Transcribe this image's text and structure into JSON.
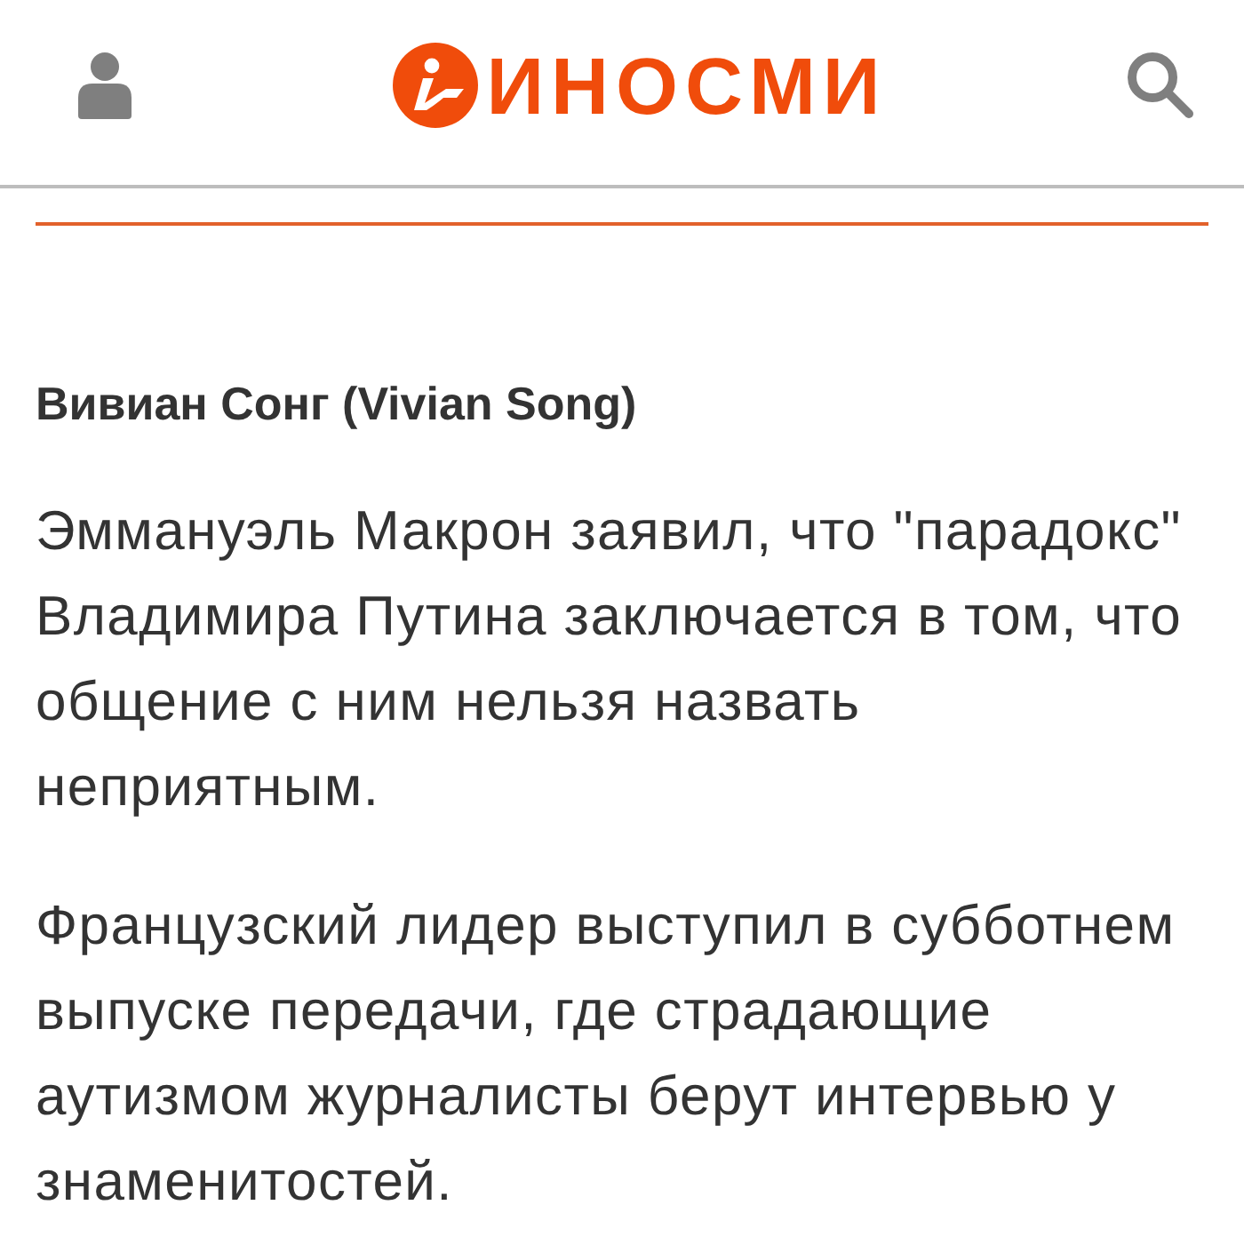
{
  "header": {
    "logo_text": "ИНОСМИ"
  },
  "author": "Вивиан Сонг (Vivian Song)",
  "paragraphs": [
    "Эммануэль Макрон заявил, что \"парадокс\" Владимира Путина заключается в том, что общение с ним нельзя назвать неприятным.",
    "Французский лидер выступил в субботнем выпуске передачи, где страдающие аутизмом журналисты берут интервью у знаменитостей."
  ]
}
